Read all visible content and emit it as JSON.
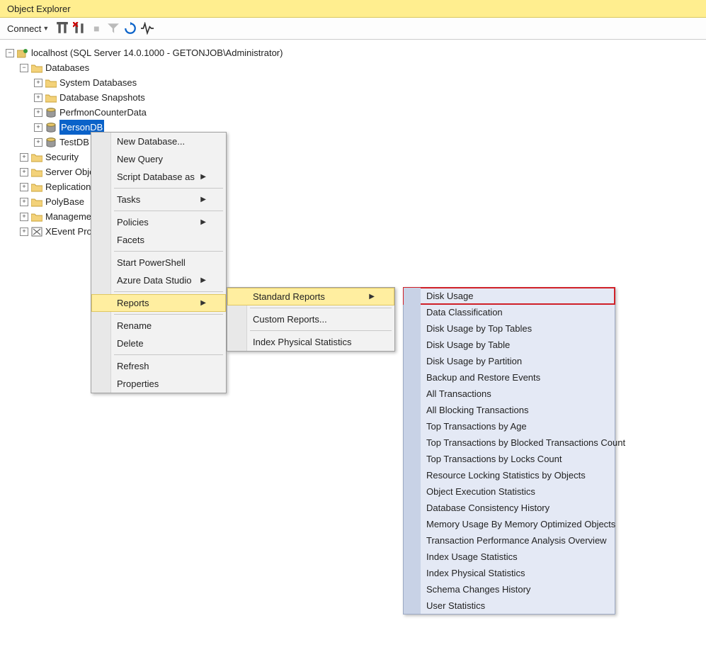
{
  "window": {
    "title": "Object Explorer"
  },
  "toolbar": {
    "connect": "Connect"
  },
  "tree": {
    "root": "localhost (SQL Server 14.0.1000 - GETONJOB\\Administrator)",
    "databases": "Databases",
    "sysdb": "System Databases",
    "snapshots": "Database Snapshots",
    "perfmon": "PerfmonCounterData",
    "persondb": "PersonDB",
    "testdb": "TestDB",
    "security": "Security",
    "serverobj": "Server Objects",
    "replication": "Replication",
    "polybase": "PolyBase",
    "management": "Management",
    "xevent": "XEvent Profiler"
  },
  "contextMenu": {
    "newdb": "New Database...",
    "newq": "New Query",
    "script": "Script Database as",
    "tasks": "Tasks",
    "policies": "Policies",
    "facets": "Facets",
    "powershell": "Start PowerShell",
    "azure": "Azure Data Studio",
    "reports": "Reports",
    "rename": "Rename",
    "delete": "Delete",
    "refresh": "Refresh",
    "properties": "Properties"
  },
  "reportsSub": {
    "standard": "Standard Reports",
    "custom": "Custom Reports...",
    "indexphys": "Index Physical Statistics"
  },
  "standardReports": {
    "disk_usage": "Disk Usage",
    "data_class": "Data Classification",
    "disk_top": "Disk Usage by Top Tables",
    "disk_table": "Disk Usage by Table",
    "disk_part": "Disk Usage by Partition",
    "backup": "Backup and Restore Events",
    "all_tx": "All Transactions",
    "all_block": "All Blocking Transactions",
    "tx_age": "Top Transactions by Age",
    "tx_block": "Top Transactions by Blocked Transactions Count",
    "tx_locks": "Top Transactions by Locks Count",
    "res_lock": "Resource Locking Statistics by Objects",
    "obj_exec": "Object Execution Statistics",
    "db_consist": "Database Consistency History",
    "mem_opt": "Memory Usage By Memory Optimized Objects",
    "tx_perf": "Transaction Performance Analysis Overview",
    "idx_usage": "Index Usage Statistics",
    "idx_phys": "Index Physical Statistics",
    "schema": "Schema Changes History",
    "user_stats": "User Statistics"
  }
}
